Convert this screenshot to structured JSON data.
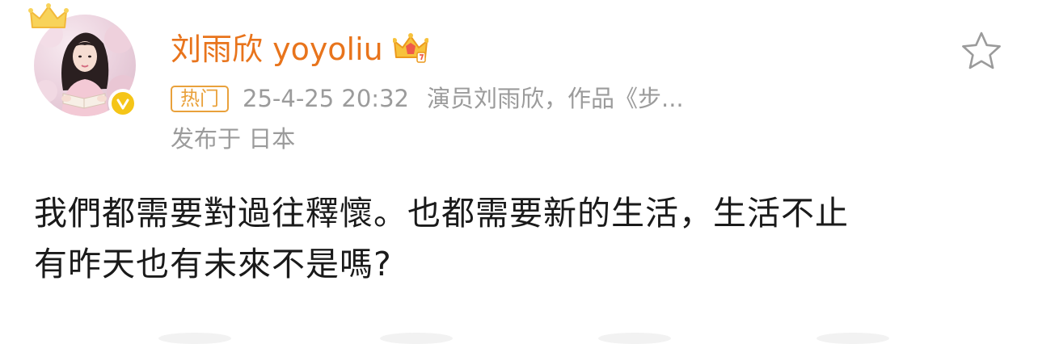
{
  "user": {
    "name": "刘雨欣 yoyoliu"
  },
  "meta": {
    "hot_tag": "热门",
    "time": "25-4-25 20:32",
    "description": "演员刘雨欣，作品《步...",
    "location": "发布于 日本"
  },
  "post": {
    "text_line1": "我們都需要對過往釋懷。也都需要新的生活，生活不止",
    "text_line2": "有昨天也有未來不是嗎?"
  },
  "icons": {
    "favorite": "star-outline-icon",
    "verified": "verified-badge-icon",
    "vip": "vip-crown-icon",
    "avatar_crown": "crown-icon"
  },
  "colors": {
    "username": "#e8741c",
    "hot_tag": "#e9a13b",
    "meta": "#9b9b9b",
    "text": "#1a1a1a",
    "verified": "#f5c518"
  }
}
